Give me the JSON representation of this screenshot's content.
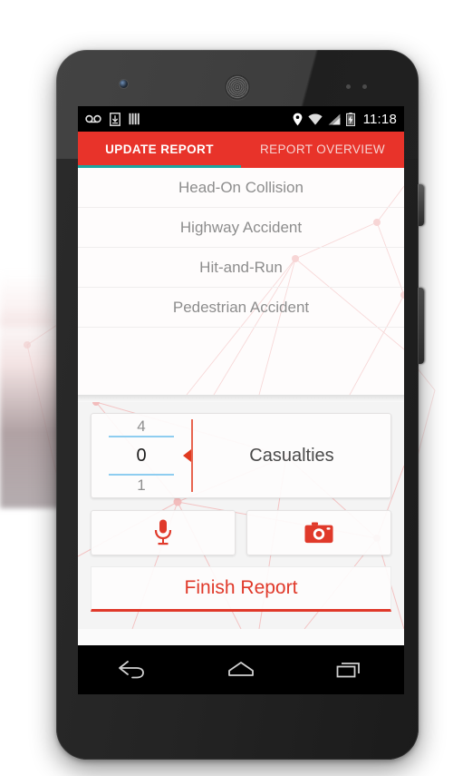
{
  "device": {
    "type": "android-phone",
    "front_camera": "front-camera",
    "earpiece": "earpiece-speaker",
    "power_button": "power-button",
    "volume_button": "volume-rocker"
  },
  "statusbar": {
    "icons_left": [
      "voicemail-icon",
      "download-icon",
      "sim-bars-icon"
    ],
    "icons_right": [
      "location-pin-icon",
      "wifi-icon",
      "cellular-signal-icon",
      "battery-charging-icon"
    ],
    "time": "11:18"
  },
  "tabs": {
    "active_index": 0,
    "indicator_color": "#1aa5a0",
    "bar_color": "#e8332a",
    "items": [
      {
        "label": "UPDATE REPORT"
      },
      {
        "label": "REPORT OVERVIEW"
      }
    ]
  },
  "list": {
    "items": [
      {
        "label": "Head-On Collision"
      },
      {
        "label": "Highway Accident"
      },
      {
        "label": "Hit-and-Run"
      },
      {
        "label": "Pedestrian Accident"
      }
    ]
  },
  "counter": {
    "value": "0",
    "value_above": "4",
    "value_below": "1",
    "label": "Casualties",
    "arrow": "left-arrow-marker",
    "line_color": "#8ecdf0",
    "divider_color": "#e8644f"
  },
  "media": {
    "mic_button": "microphone-icon",
    "camera_button": "camera-icon",
    "accent_color": "#e0392a"
  },
  "finish": {
    "label": "Finish Report",
    "color": "#e0392a"
  },
  "navbar": {
    "back": "back-icon",
    "home": "home-icon",
    "recents": "recents-icon"
  }
}
